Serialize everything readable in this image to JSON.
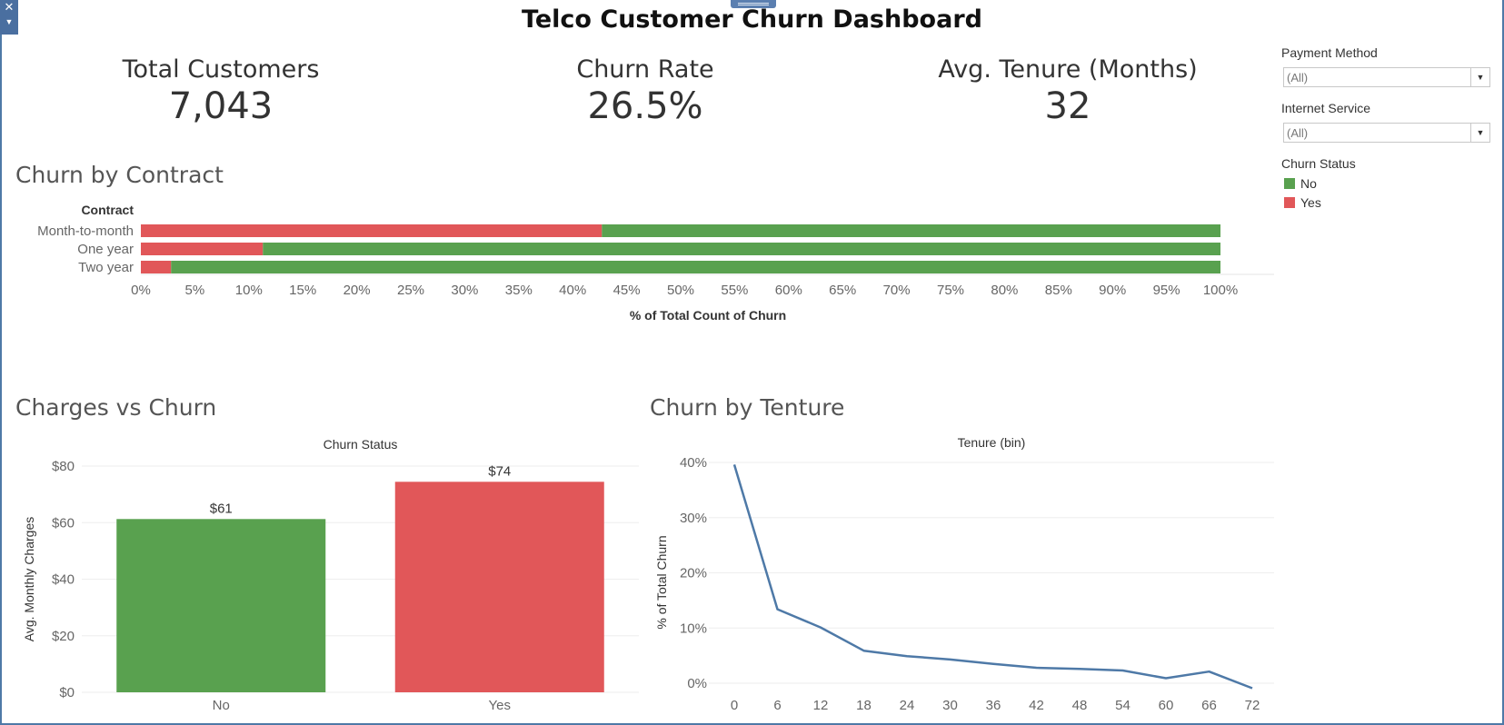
{
  "dashboard": {
    "title": "Telco Customer Churn Dashboard"
  },
  "kpis": [
    {
      "label": "Total Customers",
      "value": "7,043"
    },
    {
      "label": "Churn Rate",
      "value": "26.5%"
    },
    {
      "label": "Avg. Tenure (Months)",
      "value": "32"
    }
  ],
  "sections": {
    "contract": "Churn by Contract",
    "charges": "Charges vs Churn",
    "tenure": "Churn by Tenture"
  },
  "filters": {
    "payment": {
      "label": "Payment Method",
      "value": "(All)"
    },
    "internet": {
      "label": "Internet Service",
      "value": "(All)"
    }
  },
  "legend": {
    "title": "Churn Status",
    "items": [
      {
        "label": "No",
        "color": "#59a14f"
      },
      {
        "label": "Yes",
        "color": "#e15759"
      }
    ]
  },
  "colors": {
    "no": "#59a14f",
    "yes": "#e15759",
    "line": "#4e79a7"
  },
  "icons": {
    "close": "close-icon",
    "menu": "chevron-down-icon",
    "dropdown": "chevron-down-icon"
  },
  "chart_data": [
    {
      "id": "contract",
      "type": "bar",
      "orientation": "horizontal-stacked-100",
      "row_header": "Contract",
      "categories": [
        "Month-to-month",
        "One year",
        "Two year"
      ],
      "series": [
        {
          "name": "Yes",
          "values": [
            42.7,
            11.3,
            2.8
          ]
        },
        {
          "name": "No",
          "values": [
            57.3,
            88.7,
            97.2
          ]
        }
      ],
      "xlabel": "% of Total Count of Churn",
      "xlim": [
        0,
        100
      ],
      "xticks": [
        "0%",
        "5%",
        "10%",
        "15%",
        "20%",
        "25%",
        "30%",
        "35%",
        "40%",
        "45%",
        "50%",
        "55%",
        "60%",
        "65%",
        "70%",
        "75%",
        "80%",
        "85%",
        "90%",
        "95%",
        "100%"
      ]
    },
    {
      "id": "charges",
      "type": "bar",
      "header": "Churn Status",
      "categories": [
        "No",
        "Yes"
      ],
      "values": [
        61.27,
        74.44
      ],
      "value_labels": [
        "$61",
        "$74"
      ],
      "ylabel": "Avg. Monthly Charges",
      "ylim": [
        0,
        80
      ],
      "yticks": [
        {
          "v": 0,
          "label": "$0"
        },
        {
          "v": 20,
          "label": "$20"
        },
        {
          "v": 40,
          "label": "$40"
        },
        {
          "v": 60,
          "label": "$60"
        },
        {
          "v": 80,
          "label": "$80"
        }
      ]
    },
    {
      "id": "tenure",
      "type": "line",
      "header": "Tenure (bin)",
      "x": [
        0,
        6,
        12,
        18,
        24,
        30,
        36,
        42,
        48,
        54,
        60,
        66,
        72
      ],
      "y": [
        39.6,
        13.4,
        10.1,
        5.9,
        4.9,
        4.3,
        3.5,
        2.8,
        2.6,
        2.3,
        0.9,
        2.1,
        -0.9
      ],
      "ylabel": "% of Total Churn",
      "ylim": [
        -1.5,
        40
      ],
      "yticks": [
        {
          "v": 0,
          "label": "0%"
        },
        {
          "v": 10,
          "label": "10%"
        },
        {
          "v": 20,
          "label": "20%"
        },
        {
          "v": 30,
          "label": "30%"
        },
        {
          "v": 40,
          "label": "40%"
        }
      ],
      "xticks": [
        "0",
        "6",
        "12",
        "18",
        "24",
        "30",
        "36",
        "42",
        "48",
        "54",
        "60",
        "66",
        "72"
      ]
    }
  ]
}
